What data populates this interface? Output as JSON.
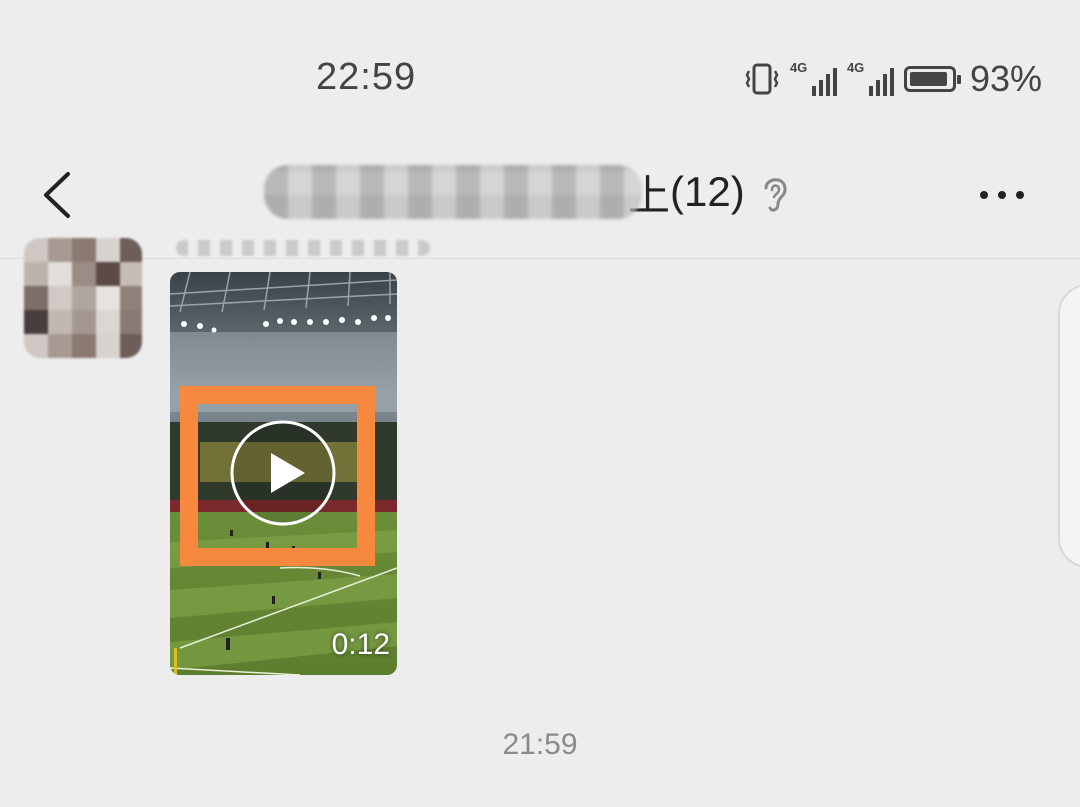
{
  "status_bar": {
    "time": "22:59",
    "battery_percent": "93%",
    "battery_level": 0.93,
    "sim1_tag": "4G",
    "sim2_tag": "4G",
    "icons": [
      "vibrate-icon",
      "signal-icon",
      "signal-icon",
      "battery-icon"
    ]
  },
  "nav": {
    "title_suffix": "(12)",
    "title_partial": "上",
    "back_icon": "back-chevron-icon",
    "ear_icon": "ear-icon",
    "more_icon": "more-dots-icon"
  },
  "message": {
    "video_duration": "0:12",
    "play_icon": "play-icon"
  },
  "timestamp": "21:59",
  "colors": {
    "background": "#ededed",
    "highlight": "#f6893d",
    "text": "#222222"
  }
}
